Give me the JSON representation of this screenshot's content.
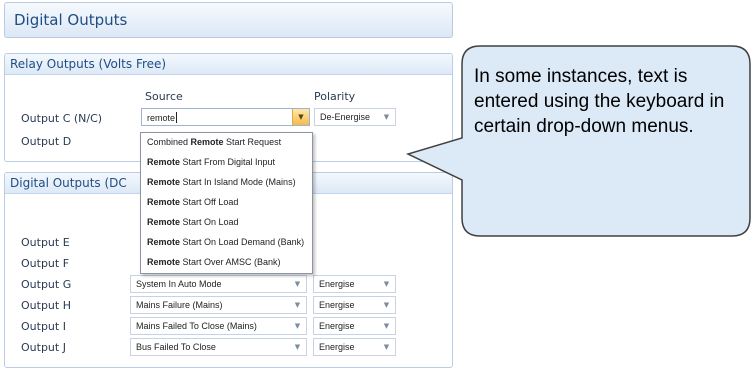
{
  "window": {
    "title": "Digital Outputs"
  },
  "relay_panel": {
    "title": "Relay Outputs (Volts Free)",
    "source_header": "Source",
    "polarity_header": "Polarity",
    "rows": [
      {
        "label": "Output C (N/C)",
        "source_value": "remote",
        "polarity": "De-Energise"
      },
      {
        "label": "Output D"
      }
    ]
  },
  "dropdown": {
    "items": [
      {
        "pre": "Combined ",
        "bold": "Remote",
        "post": " Start Request"
      },
      {
        "pre": "",
        "bold": "Remote",
        "post": " Start From Digital Input"
      },
      {
        "pre": "",
        "bold": "Remote",
        "post": " Start In Island Mode (Mains)"
      },
      {
        "pre": "",
        "bold": "Remote",
        "post": " Start Off Load"
      },
      {
        "pre": "",
        "bold": "Remote",
        "post": " Start On Load"
      },
      {
        "pre": "",
        "bold": "Remote",
        "post": " Start On Load Demand (Bank)"
      },
      {
        "pre": "",
        "bold": "Remote",
        "post": " Start Over AMSC (Bank)"
      }
    ]
  },
  "dc_panel": {
    "title": "Digital Outputs (DC",
    "rows": [
      {
        "label": "Output E"
      },
      {
        "label": "Output F"
      },
      {
        "label": "Output G",
        "source": "System In Auto Mode",
        "polarity": "Energise"
      },
      {
        "label": "Output H",
        "source": "Mains Failure (Mains)",
        "polarity": "Energise"
      },
      {
        "label": "Output I",
        "source": "Mains Failed To Close (Mains)",
        "polarity": "Energise"
      },
      {
        "label": "Output J",
        "source": "Bus Failed To Close",
        "polarity": "Energise"
      }
    ]
  },
  "callout": {
    "text": "In some instances, text is entered using the keyboard in certain drop-down menus."
  },
  "icons": {
    "dropdown_arrow": "chevron-down-icon"
  },
  "colors": {
    "title_text": "#1f4d83",
    "panel_border": "#b9cde6",
    "callout_fill": "#dce9f7",
    "callout_border": "#404040",
    "active_arrow": "#f6b94f"
  }
}
